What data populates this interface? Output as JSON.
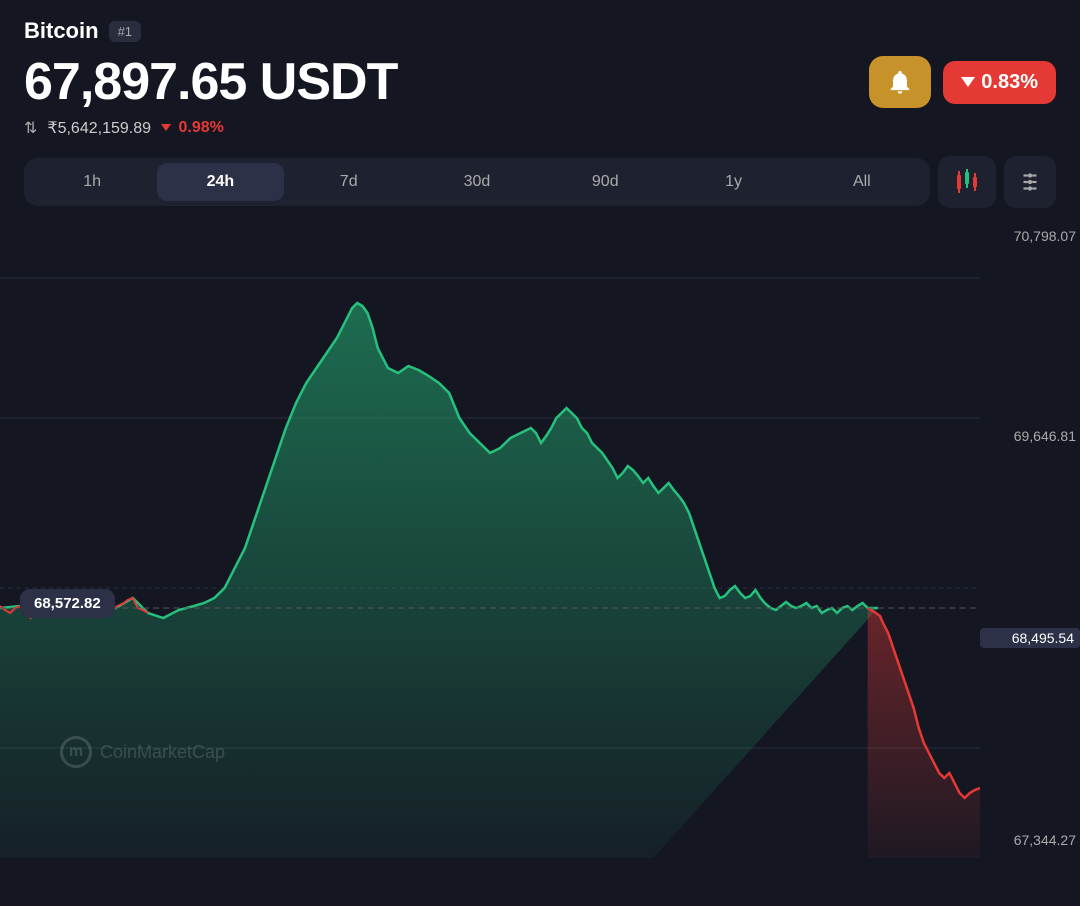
{
  "coin": {
    "name": "Bitcoin",
    "rank": "#1"
  },
  "price": {
    "main": "67,897.65 USDT",
    "inr": "₹5,642,159.89",
    "change_pct_inr": "0.98%",
    "change_pct_usdt": "0.83%"
  },
  "timeframes": [
    "1h",
    "24h",
    "7d",
    "30d",
    "90d",
    "1y",
    "All"
  ],
  "active_timeframe": "24h",
  "chart_labels": {
    "top": "70,798.07",
    "mid_upper": "69,646.81",
    "mid": "68,495.54",
    "bottom": "67,344.27"
  },
  "tooltip": "68,572.82",
  "watermark": "CoinMarketCap",
  "buttons": {
    "bell": "🔔",
    "chart_type": "candlestick",
    "settings": "settings"
  }
}
